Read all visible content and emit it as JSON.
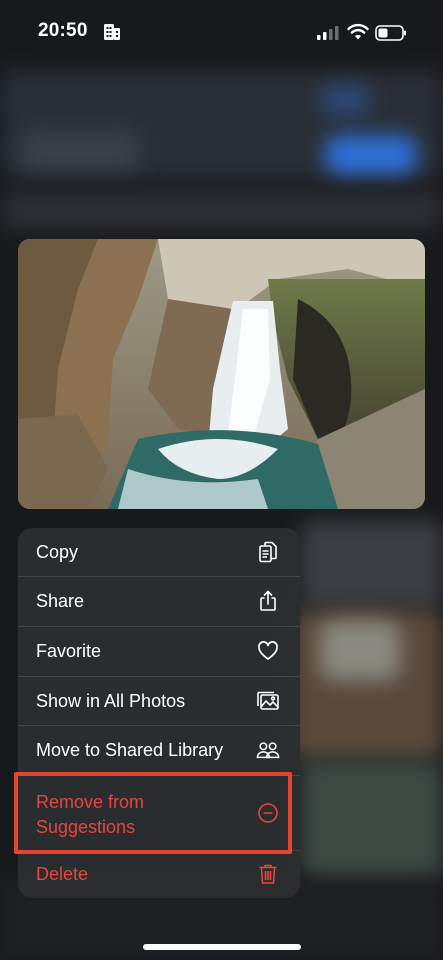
{
  "status_bar": {
    "time": "20:50",
    "icons": [
      "building-icon",
      "cellular-signal-icon",
      "wifi-icon",
      "battery-icon"
    ]
  },
  "preview": {
    "subject": "waterfall-photo"
  },
  "context_menu": {
    "items": [
      {
        "label": "Copy",
        "icon": "copy-icon",
        "destructive": false
      },
      {
        "label": "Share",
        "icon": "share-icon",
        "destructive": false
      },
      {
        "label": "Favorite",
        "icon": "heart-icon",
        "destructive": false
      },
      {
        "label": "Show in All Photos",
        "icon": "photos-icon",
        "destructive": false
      },
      {
        "label": "Move to Shared Library",
        "icon": "people-icon",
        "destructive": false
      },
      {
        "label": "Remove from Suggestions",
        "icon": "minus-circle-icon",
        "destructive": true
      },
      {
        "label": "Delete",
        "icon": "trash-icon",
        "destructive": true
      }
    ]
  },
  "colors": {
    "destructive": "#e8453c",
    "highlight_box": "#e5452f"
  }
}
